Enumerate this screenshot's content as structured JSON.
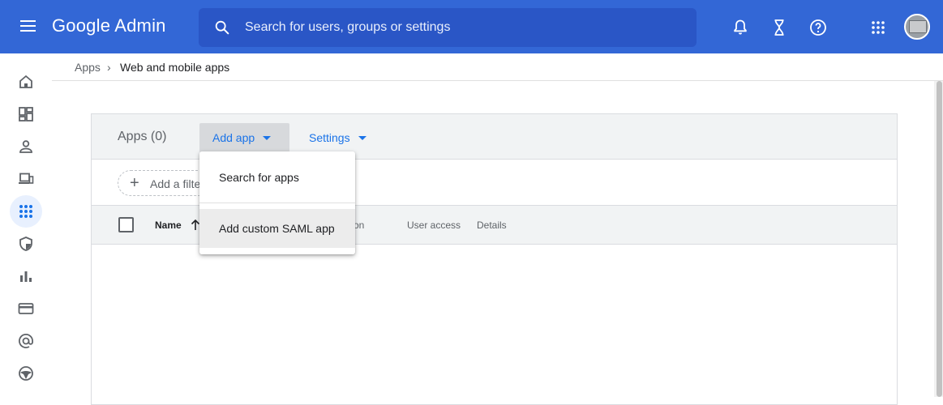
{
  "header": {
    "title": "Google Admin",
    "search_placeholder": "Search for users, groups or settings",
    "bg_color": "#3367d6"
  },
  "breadcrumb": {
    "root": "Apps",
    "separator": "›",
    "current": "Web and mobile apps"
  },
  "rail": {
    "items": [
      "home-icon",
      "dashboard-icon",
      "person-icon",
      "devices-icon",
      "apps-icon",
      "security-icon",
      "reports-icon",
      "billing-icon",
      "account-icon",
      "rules-icon"
    ],
    "active": "apps-icon"
  },
  "card": {
    "apps_count": "Apps (0)",
    "add_app_label": "Add app",
    "settings_label": "Settings",
    "filter_label": "Add a filter",
    "columns": {
      "name": "Name",
      "platform": "on",
      "user_access": "User access",
      "details": "Details"
    }
  },
  "dropdown": {
    "items": [
      "Search for apps",
      "Add custom SAML app"
    ],
    "highlighted_index": 1
  },
  "colors": {
    "accent": "#1a73e8",
    "header_row": "#f1f3f4"
  }
}
